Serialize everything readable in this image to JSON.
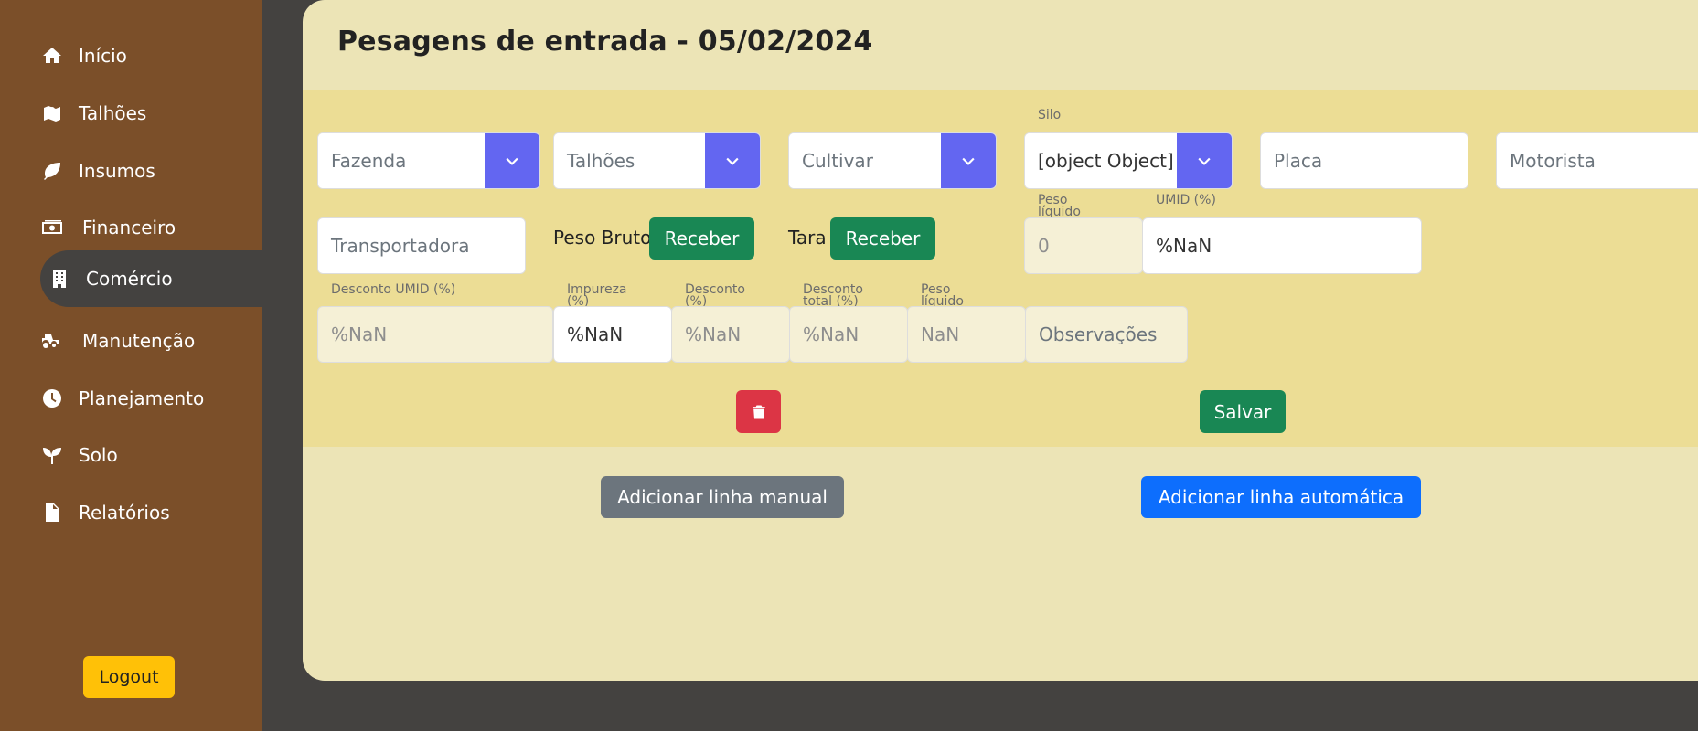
{
  "sidebar": {
    "items": [
      {
        "label": "Início",
        "icon": "home-icon"
      },
      {
        "label": "Talhões",
        "icon": "map-icon"
      },
      {
        "label": "Insumos",
        "icon": "leaf-icon"
      },
      {
        "label": "Financeiro",
        "icon": "money-icon"
      },
      {
        "label": "Comércio",
        "icon": "building-icon"
      },
      {
        "label": "Manutenção",
        "icon": "tractor-icon"
      },
      {
        "label": "Planejamento",
        "icon": "clock-icon"
      },
      {
        "label": "Solo",
        "icon": "seedling-icon"
      },
      {
        "label": "Relatórios",
        "icon": "file-icon"
      }
    ],
    "active": "Comércio",
    "logout_label": "Logout"
  },
  "page": {
    "title": "Pesagens de entrada - 05/02/2024"
  },
  "form": {
    "fazenda_placeholder": "Fazenda",
    "talhoes_placeholder": "Talhões",
    "cultivar_placeholder": "Cultivar",
    "silo_label": "Silo",
    "silo_value": "[object Object]",
    "placa_placeholder": "Placa",
    "motorista_placeholder": "Motorista",
    "transportadora_placeholder": "Transportadora",
    "peso_bruto_label": "Peso Bruto",
    "receber_label": "Receber",
    "tara_label": "Tara",
    "peso_liquido_label": "Peso líquido",
    "peso_liquido_value": "0",
    "umid_label": "UMID (%)",
    "umid_value": "%NaN",
    "desconto_umid_label": "Desconto UMID (%)",
    "desconto_umid_value": "%NaN",
    "impureza_label": "Impureza (%)",
    "impureza_value": "%NaN",
    "desconto_label": "Desconto (%)",
    "desconto_value": "%NaN",
    "desconto_total_label": "Desconto total (%)",
    "desconto_total_value": "%NaN",
    "peso_liquido2_label": "Peso líquido",
    "peso_liquido2_value": "NaN",
    "observacoes_placeholder": "Observações",
    "salvar_label": "Salvar"
  },
  "actions": {
    "add_manual_label": "Adicionar linha manual",
    "add_auto_label": "Adicionar linha automática"
  },
  "colors": {
    "sidebar": "#7b4f29",
    "background": "#444240",
    "panel": "#ece4b6",
    "form_band": "#ecdd95",
    "select_chevron": "#6366f1",
    "green": "#198754",
    "red": "#dc3545",
    "gray": "#6c757d",
    "blue": "#0d6efd",
    "logout": "#ffc107"
  }
}
